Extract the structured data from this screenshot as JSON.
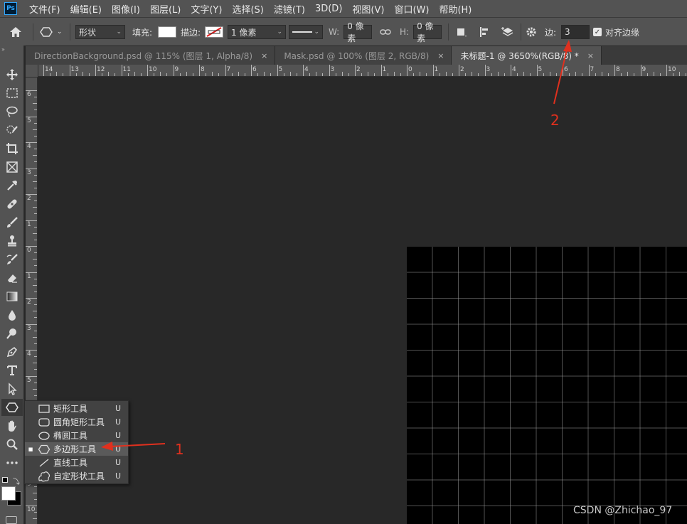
{
  "app": {
    "logo": "Ps"
  },
  "menu": [
    "文件(F)",
    "编辑(E)",
    "图像(I)",
    "图层(L)",
    "文字(Y)",
    "选择(S)",
    "滤镜(T)",
    "3D(D)",
    "视图(V)",
    "窗口(W)",
    "帮助(H)"
  ],
  "options": {
    "mode": "形状",
    "fill_label": "填充:",
    "stroke_label": "描边:",
    "stroke_width": "1 像素",
    "w_label": "W:",
    "w_value": "0 像素",
    "h_label": "H:",
    "h_value": "0 像素",
    "sides_label": "边:",
    "sides_value": "3",
    "align_edges_label": "对齐边缘",
    "align_edges_checked": true
  },
  "tabs": [
    {
      "label": "DirectionBackground.psd @ 115% (图层 1, Alpha/8)",
      "close": "×",
      "active": false
    },
    {
      "label": "Mask.psd @ 100% (图层 2, RGB/8)",
      "close": "×",
      "active": false
    },
    {
      "label": "未标题-1 @ 3650%(RGB/8) *",
      "close": "×",
      "active": true
    }
  ],
  "ruler_top": [
    "14",
    "13",
    "12",
    "11",
    "10",
    "9",
    "8",
    "7",
    "6",
    "5",
    "4",
    "3",
    "2",
    "1",
    "0",
    "1",
    "2",
    "3",
    "4",
    "5",
    "6",
    "7",
    "8",
    "9",
    "10"
  ],
  "ruler_left": [
    "6",
    "5",
    "4",
    "3",
    "2",
    "1",
    "0",
    "1",
    "2",
    "3",
    "4",
    "5",
    "6",
    "7",
    "8",
    "9",
    "10"
  ],
  "flyout": [
    {
      "label": "矩形工具",
      "key": "U",
      "icon": "rectangle-icon",
      "selected": false
    },
    {
      "label": "圆角矩形工具",
      "key": "U",
      "icon": "rounded-rectangle-icon",
      "selected": false
    },
    {
      "label": "椭圆工具",
      "key": "U",
      "icon": "ellipse-icon",
      "selected": false
    },
    {
      "label": "多边形工具",
      "key": "U",
      "icon": "polygon-icon",
      "selected": true
    },
    {
      "label": "直线工具",
      "key": "U",
      "icon": "line-icon",
      "selected": false
    },
    {
      "label": "自定形状工具",
      "key": "U",
      "icon": "custom-shape-icon",
      "selected": false
    }
  ],
  "annotations": {
    "one": "1",
    "two": "2"
  },
  "annotation_color": "#e0301e",
  "watermark": "CSDN @Zhichao_97"
}
